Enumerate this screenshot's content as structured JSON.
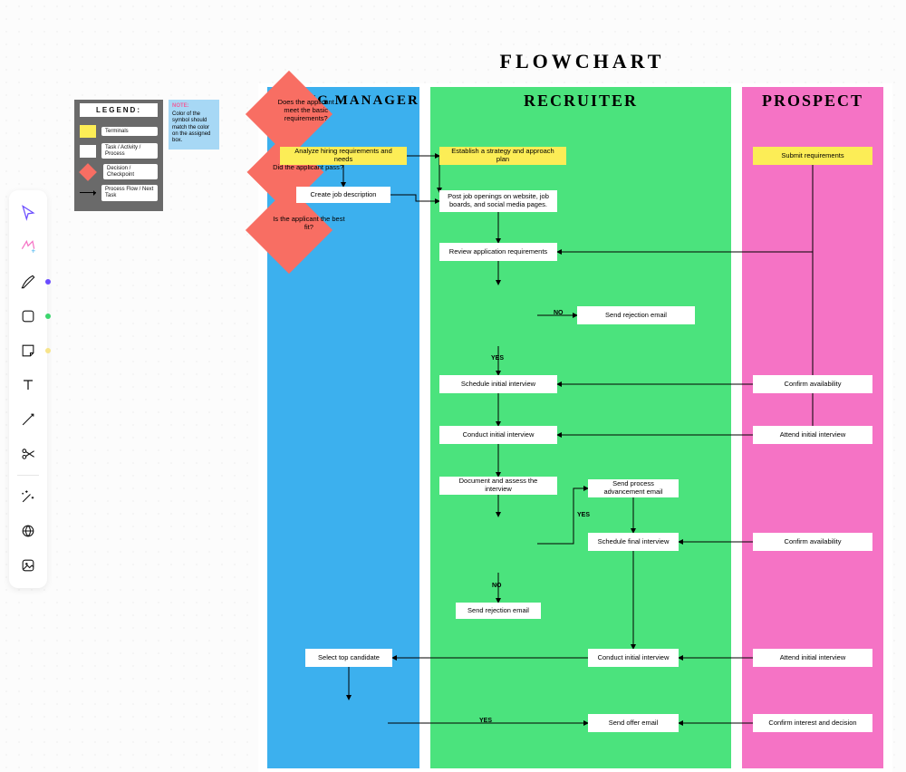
{
  "title": "FLOWCHART",
  "toolbar": {
    "tools": [
      {
        "name": "select-tool",
        "icon": "cursor"
      },
      {
        "name": "ai-tool",
        "icon": "ai-sparkle"
      },
      {
        "name": "pen-tool",
        "icon": "pen"
      },
      {
        "name": "shape-tool",
        "icon": "rect"
      },
      {
        "name": "sticky-tool",
        "icon": "sticky"
      },
      {
        "name": "text-tool",
        "icon": "text"
      },
      {
        "name": "connector-tool",
        "icon": "connector"
      },
      {
        "name": "scissors-tool",
        "icon": "scissors"
      },
      {
        "name": "magic-tool",
        "icon": "wand"
      },
      {
        "name": "globe-tool",
        "icon": "globe"
      },
      {
        "name": "image-tool",
        "icon": "image"
      }
    ],
    "dot_colors": {
      "pen": "#6a4cff",
      "shape": "#3cd66e",
      "sticky": "#f7e48b"
    }
  },
  "legend": {
    "header": "LEGEND:",
    "items": [
      {
        "swatch": "#fced56",
        "label": "Terminals"
      },
      {
        "swatch": "#ffffff",
        "label": "Task / Activity / Process"
      },
      {
        "swatch": "#f86e63",
        "kind": "diamond",
        "label": "Decision / Checkpoint"
      },
      {
        "kind": "arrow",
        "label": "Process Flow / Next Task"
      }
    ]
  },
  "note": {
    "title": "NOTE:",
    "body": "Color of the symbol should match the color on the assigned box."
  },
  "lanes": {
    "hm": "HIRING MANAGER",
    "rc": "RECRUITER",
    "pr": "PROSPECT"
  },
  "nodes": {
    "hm_analyze": "Analyze hiring requirements and needs",
    "hm_jobdesc": "Create job description",
    "rc_strategy": "Establish a strategy and approach plan",
    "rc_post": "Post job openings on website, job boards, and social media pages.",
    "rc_review": "Review application requirements",
    "rc_dec_basic": "Does the applicant meet the basic requirements?",
    "rc_reject1": "Send rejection email",
    "rc_schedule": "Schedule initial interview",
    "rc_conduct": "Conduct initial interview",
    "rc_document": "Document and assess the interview",
    "rc_dec_pass": "Did the applicant pass?",
    "rc_advance": "Send process advancement email",
    "rc_schedfinal": "Schedule final interview",
    "rc_reject2": "Send rejection email",
    "rc_conduct2": "Conduct initial interview",
    "rc_offer": "Send offer email",
    "hm_select": "Select top candidate",
    "hm_dec_fit": "Is the applicant the best fit?",
    "pr_submit": "Submit requirements",
    "pr_confirm1": "Confirm availability",
    "pr_attend1": "Attend initial interview",
    "pr_confirm2": "Confirm availability",
    "pr_attend2": "Attend initial interview",
    "pr_confirm3": "Confirm interest and decision"
  },
  "labels": {
    "no": "NO",
    "yes": "YES",
    "no2": "NO",
    "yes2": "YES",
    "yes3": "YES"
  },
  "colors": {
    "lane_hm": "#3cb0ee",
    "lane_rc": "#4be37d",
    "lane_pr": "#f573c5",
    "terminal": "#fced56",
    "decision": "#f86e63"
  }
}
